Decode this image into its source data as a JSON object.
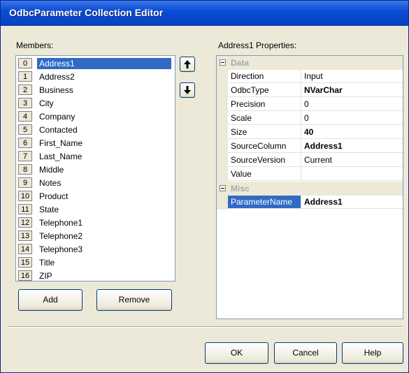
{
  "window": {
    "title": "OdbcParameter Collection Editor"
  },
  "members": {
    "label": "Members:",
    "items": [
      {
        "index": "0",
        "name": "Address1",
        "selected": true
      },
      {
        "index": "1",
        "name": "Address2"
      },
      {
        "index": "2",
        "name": "Business"
      },
      {
        "index": "3",
        "name": "City"
      },
      {
        "index": "4",
        "name": "Company"
      },
      {
        "index": "5",
        "name": "Contacted"
      },
      {
        "index": "6",
        "name": "First_Name"
      },
      {
        "index": "7",
        "name": "Last_Name"
      },
      {
        "index": "8",
        "name": "Middle"
      },
      {
        "index": "9",
        "name": "Notes"
      },
      {
        "index": "10",
        "name": "Product"
      },
      {
        "index": "11",
        "name": "State"
      },
      {
        "index": "12",
        "name": "Telephone1"
      },
      {
        "index": "13",
        "name": "Telephone2"
      },
      {
        "index": "14",
        "name": "Telephone3"
      },
      {
        "index": "15",
        "name": "Title"
      },
      {
        "index": "16",
        "name": "ZIP"
      }
    ],
    "add_label": "Add",
    "remove_label": "Remove"
  },
  "properties": {
    "label": "Address1 Properties:",
    "categories": [
      {
        "name": "Data",
        "rows": [
          {
            "name": "Direction",
            "value": "Input",
            "bold": false
          },
          {
            "name": "OdbcType",
            "value": "NVarChar",
            "bold": true
          },
          {
            "name": "Precision",
            "value": "0",
            "bold": false
          },
          {
            "name": "Scale",
            "value": "0",
            "bold": false
          },
          {
            "name": "Size",
            "value": "40",
            "bold": true
          },
          {
            "name": "SourceColumn",
            "value": "Address1",
            "bold": true
          },
          {
            "name": "SourceVersion",
            "value": "Current",
            "bold": false
          },
          {
            "name": "Value",
            "value": "",
            "bold": false
          }
        ]
      },
      {
        "name": "Misc",
        "rows": [
          {
            "name": "ParameterName",
            "value": "Address1",
            "bold": true,
            "selected": true
          }
        ]
      }
    ]
  },
  "footer": {
    "ok_label": "OK",
    "cancel_label": "Cancel",
    "help_label": "Help"
  },
  "icons": {
    "move_up": "arrow-up-icon",
    "move_down": "arrow-down-icon",
    "expand": "collapse-box-icon"
  }
}
